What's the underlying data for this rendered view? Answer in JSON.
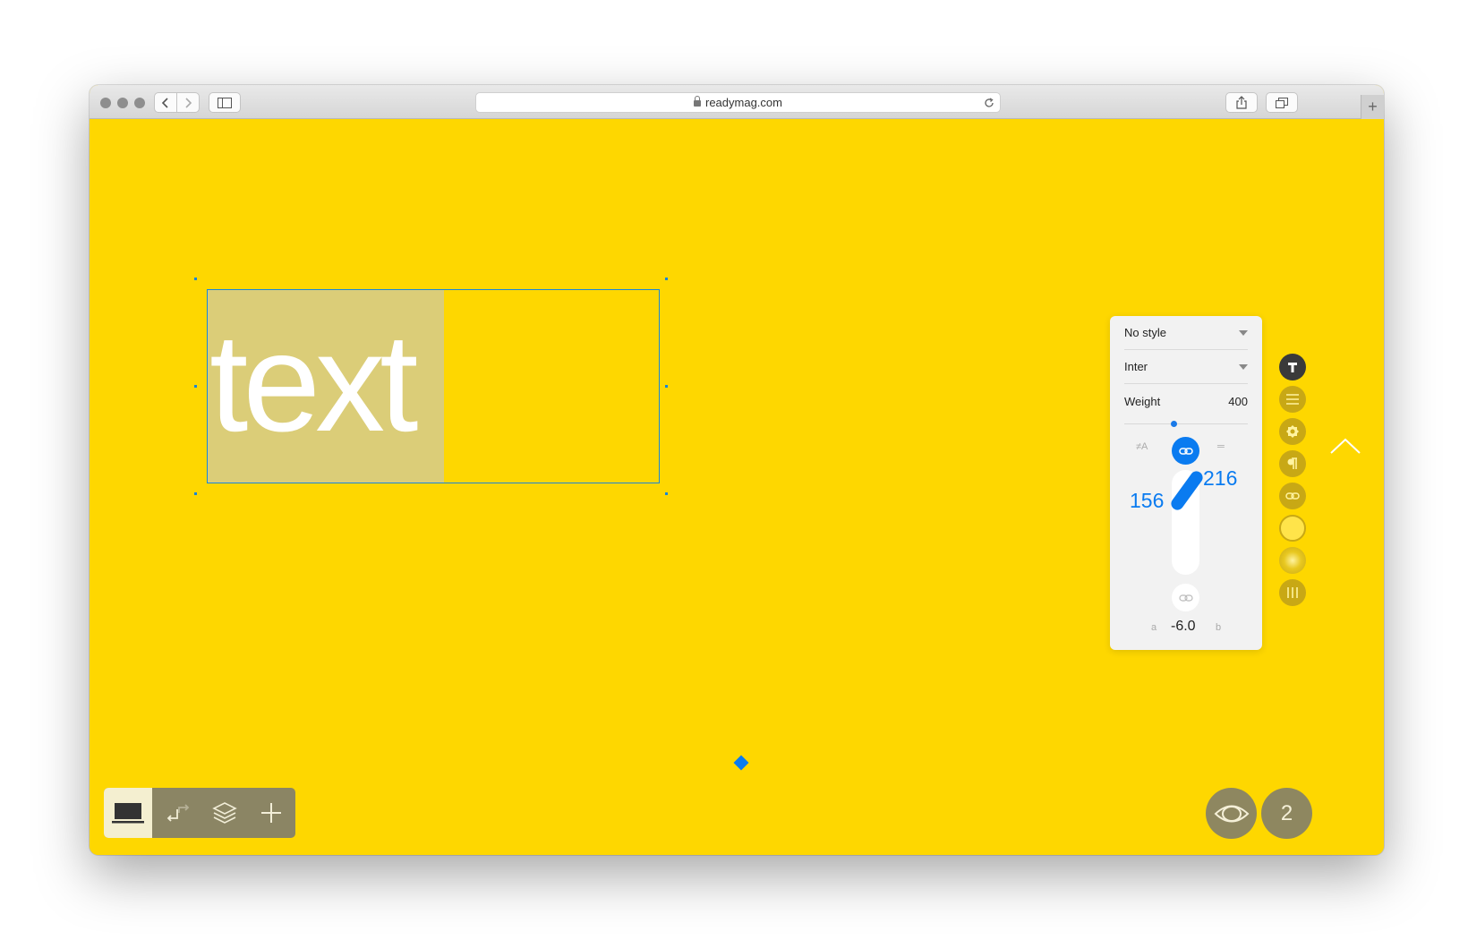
{
  "browser": {
    "url": "readymag.com",
    "new_tab_label": "+"
  },
  "canvas": {
    "background": "#FED700",
    "text_content": "text"
  },
  "panel": {
    "style_label": "No style",
    "font_label": "Inter",
    "weight_label": "Weight",
    "weight_value": "400",
    "mode_left_label": "≠A",
    "mode_right_label": "═",
    "line_height_a": "156",
    "line_height_b": "216",
    "footer_a": "a",
    "footer_value": "-6.0",
    "footer_b": "b"
  },
  "right_icons": [
    "text-icon",
    "align-icon",
    "gear-icon",
    "paragraph-icon",
    "link-icon",
    "color-icon",
    "shadow-icon",
    "columns-icon"
  ],
  "bottom_bar": {
    "page_count": "2"
  },
  "colors": {
    "accent": "#0a7bf0",
    "canvas": "#FED700",
    "toolbar": "#8B8564"
  }
}
